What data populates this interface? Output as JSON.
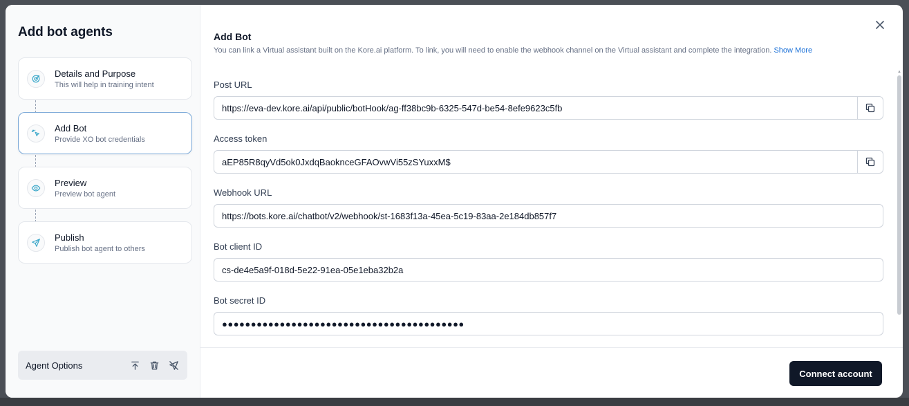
{
  "sidebar": {
    "title": "Add bot agents",
    "steps": [
      {
        "title": "Details and Purpose",
        "subtitle": "This will help in training intent",
        "icon": "target-icon"
      },
      {
        "title": "Add Bot",
        "subtitle": "Provide XO bot credentials",
        "icon": "cursor-click-icon"
      },
      {
        "title": "Preview",
        "subtitle": "Preview bot agent",
        "icon": "eye-icon"
      },
      {
        "title": "Publish",
        "subtitle": "Publish bot agent to others",
        "icon": "send-icon"
      }
    ],
    "active_step": "Add Bot",
    "agent_options": {
      "label": "Agent Options",
      "icons": [
        "upload-icon",
        "trash-icon",
        "send-off-icon"
      ]
    }
  },
  "main": {
    "title": "Add Bot",
    "description": "You can link a Virtual assistant built on the Kore.ai platform. To link, you will need to enable the webhook channel on the Virtual assistant and complete the integration.",
    "show_more": "Show More",
    "fields": [
      {
        "label": "Post URL",
        "value": "https://eva-dev.kore.ai/api/public/botHook/ag-ff38bc9b-6325-547d-be54-8efe9623c5fb",
        "copyable": true
      },
      {
        "label": "Access token",
        "value": "aEP85R8qyVd5ok0JxdqBaoknceGFAOvwVi55zSYuxxM$",
        "copyable": true
      },
      {
        "label": "Webhook URL",
        "value": "https://bots.kore.ai/chatbot/v2/webhook/st-1683f13a-45ea-5c19-83aa-2e184db857f7",
        "copyable": false
      },
      {
        "label": "Bot client ID",
        "value": "cs-de4e5a9f-018d-5e22-91ea-05e1eba32b2a",
        "copyable": false
      },
      {
        "label": "Bot secret ID",
        "value": "●●●●●●●●●●●●●●●●●●●●●●●●●●●●●●●●●●●●●●●●●●",
        "copyable": false
      }
    ],
    "connect_button": "Connect account"
  },
  "colors": {
    "accent_link": "#1d72d8",
    "icon_teal": "#3aa7c9",
    "primary_button": "#101828",
    "active_border": "#7aa8d8"
  }
}
